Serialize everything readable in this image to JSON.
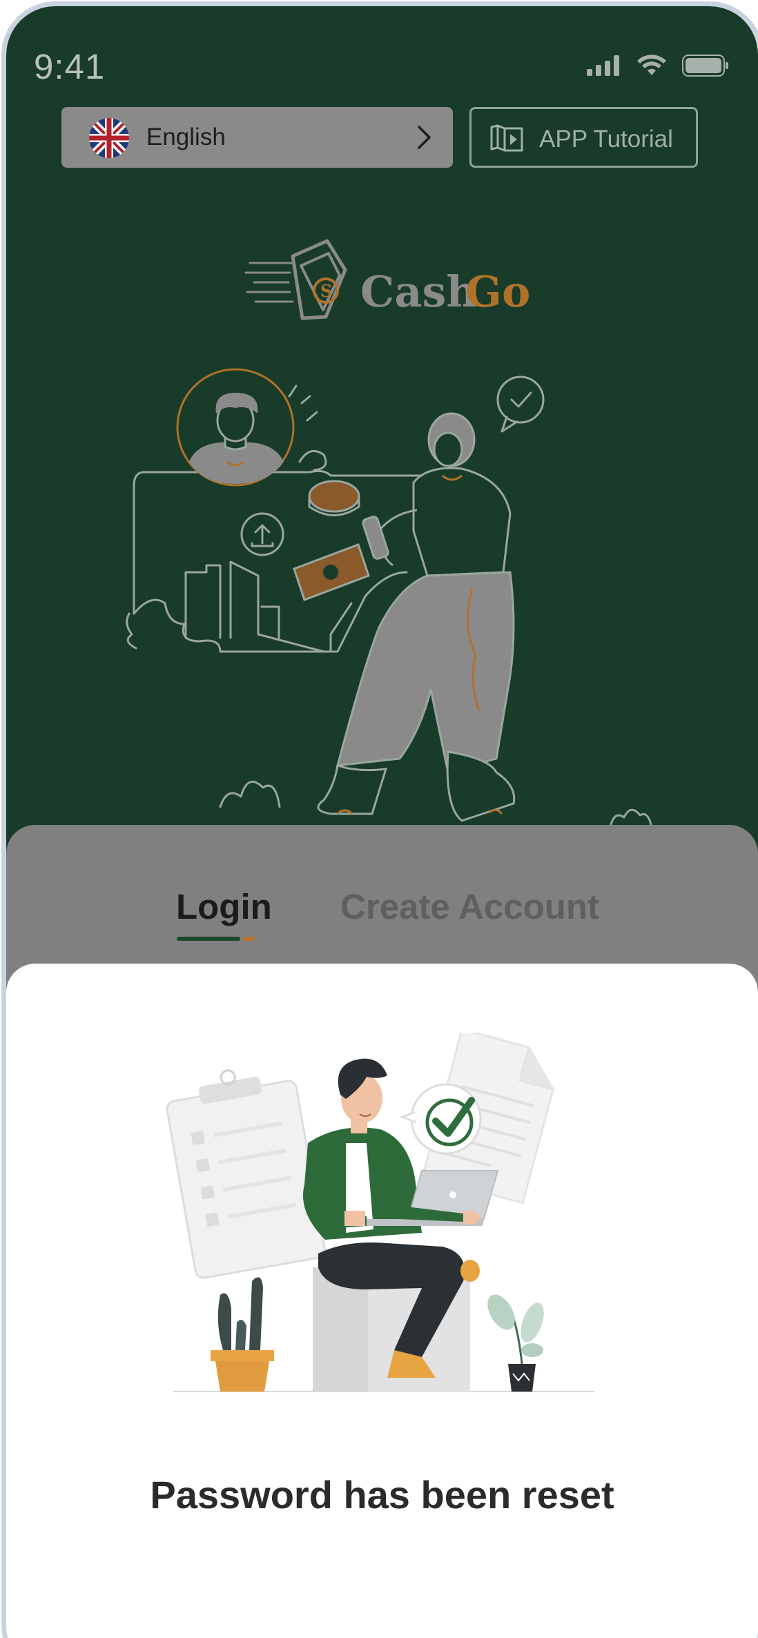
{
  "status_bar": {
    "time": "9:41"
  },
  "language_selector": {
    "label": "English",
    "flag_icon": "uk-flag-icon"
  },
  "tutorial_button": {
    "label": "APP Tutorial",
    "icon": "book-play-icon"
  },
  "brand": {
    "logo_text_part1": "Cash",
    "logo_text_part2": "Go",
    "color_part1": "#8a8a8a",
    "color_part2": "#b0722a"
  },
  "tabs": {
    "login": "Login",
    "create_account": "Create Account"
  },
  "sheet": {
    "message": "Password has been reset"
  },
  "colors": {
    "background_green": "#193b29",
    "accent_orange": "#b8702a",
    "panel_gray": "#808080"
  }
}
